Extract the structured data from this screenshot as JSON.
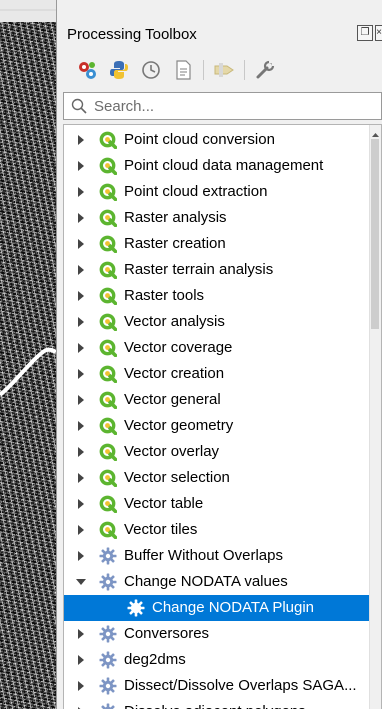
{
  "panel": {
    "title": "Processing Toolbox",
    "toolbar": [
      "gear-models-icon",
      "python-icon",
      "history-icon",
      "results-icon",
      "edit-features-icon",
      "settings-wrench-icon"
    ]
  },
  "search": {
    "placeholder": "Search..."
  },
  "tree": {
    "items": [
      {
        "label": "Point cloud conversion",
        "icon": "qgis-icon",
        "expanded": false
      },
      {
        "label": "Point cloud data management",
        "icon": "qgis-icon",
        "expanded": false
      },
      {
        "label": "Point cloud extraction",
        "icon": "qgis-icon",
        "expanded": false
      },
      {
        "label": "Raster analysis",
        "icon": "qgis-icon",
        "expanded": false
      },
      {
        "label": "Raster creation",
        "icon": "qgis-icon",
        "expanded": false
      },
      {
        "label": "Raster terrain analysis",
        "icon": "qgis-icon",
        "expanded": false
      },
      {
        "label": "Raster tools",
        "icon": "qgis-icon",
        "expanded": false
      },
      {
        "label": "Vector analysis",
        "icon": "qgis-icon",
        "expanded": false
      },
      {
        "label": "Vector coverage",
        "icon": "qgis-icon",
        "expanded": false
      },
      {
        "label": "Vector creation",
        "icon": "qgis-icon",
        "expanded": false
      },
      {
        "label": "Vector general",
        "icon": "qgis-icon",
        "expanded": false
      },
      {
        "label": "Vector geometry",
        "icon": "qgis-icon",
        "expanded": false
      },
      {
        "label": "Vector overlay",
        "icon": "qgis-icon",
        "expanded": false
      },
      {
        "label": "Vector selection",
        "icon": "qgis-icon",
        "expanded": false
      },
      {
        "label": "Vector table",
        "icon": "qgis-icon",
        "expanded": false
      },
      {
        "label": "Vector tiles",
        "icon": "qgis-icon",
        "expanded": false
      },
      {
        "label": "Buffer Without Overlaps",
        "icon": "plugin-gear-icon",
        "expanded": false
      },
      {
        "label": "Change NODATA values",
        "icon": "plugin-gear-icon",
        "expanded": true
      },
      {
        "label": "Change NODATA Plugin",
        "icon": "plugin-gear-icon",
        "child": true,
        "selected": true
      },
      {
        "label": "Conversores",
        "icon": "plugin-gear-icon",
        "expanded": false
      },
      {
        "label": "deg2dms",
        "icon": "plugin-gear-icon",
        "expanded": false
      },
      {
        "label": "Dissect/Dissolve Overlaps SAGA...",
        "icon": "plugin-gear-icon",
        "expanded": false
      },
      {
        "label": "Dissolve adjacent polygons",
        "icon": "plugin-gear-icon",
        "expanded": false
      }
    ]
  },
  "colors": {
    "selection": "#0078d7",
    "qgis_green": "#5cb530",
    "plugin_blue": "#7d95c4"
  }
}
